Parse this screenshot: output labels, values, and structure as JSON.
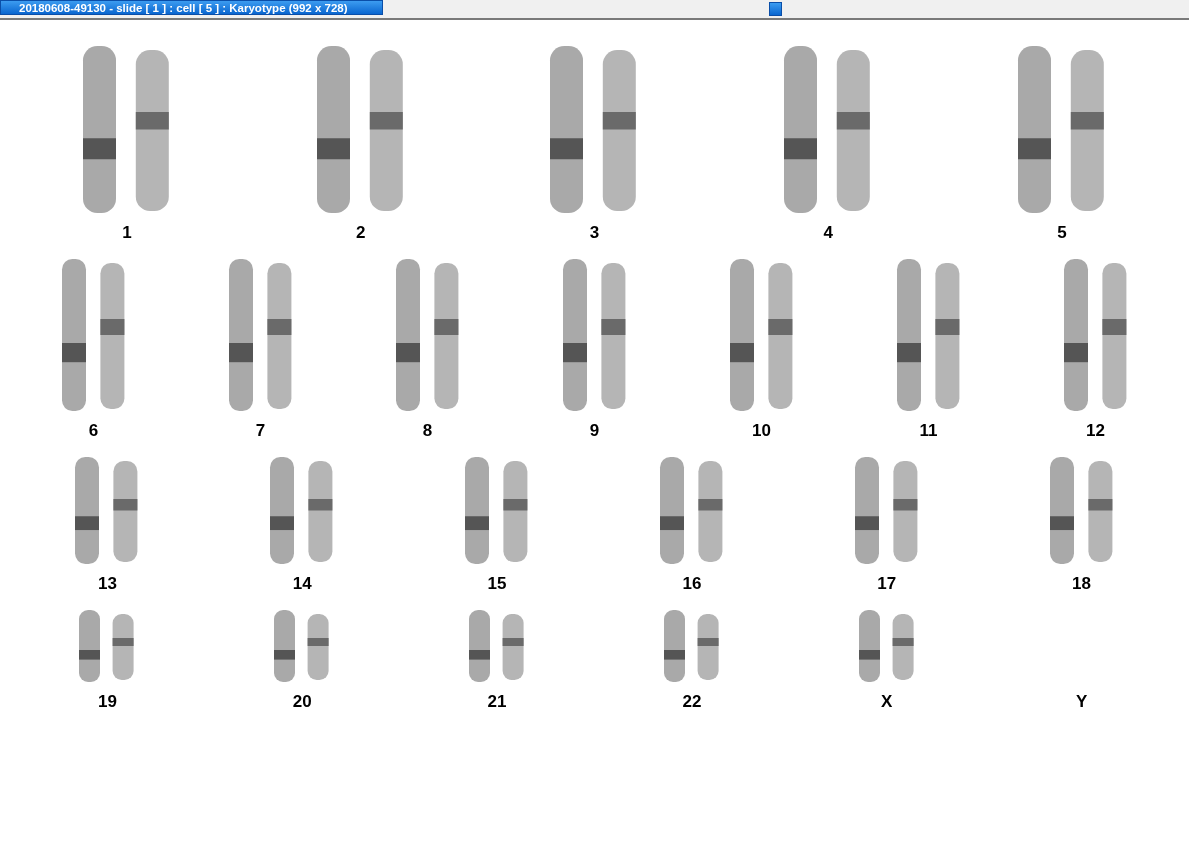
{
  "window": {
    "title": "20180608-49130 - slide [ 1 ] : cell [ 5 ] : Karyotype  (992 x 728)"
  },
  "rows": [
    [
      {
        "label": "1",
        "kind": "pair"
      },
      {
        "label": "2",
        "kind": "pair"
      },
      {
        "label": "3",
        "kind": "pair"
      },
      {
        "label": "4",
        "kind": "pair"
      },
      {
        "label": "5",
        "kind": "pair"
      }
    ],
    [
      {
        "label": "6",
        "kind": "pair"
      },
      {
        "label": "7",
        "kind": "pair"
      },
      {
        "label": "8",
        "kind": "pair"
      },
      {
        "label": "9",
        "kind": "pair"
      },
      {
        "label": "10",
        "kind": "pair"
      },
      {
        "label": "11",
        "kind": "pair"
      },
      {
        "label": "12",
        "kind": "pair"
      }
    ],
    [
      {
        "label": "13",
        "kind": "pair"
      },
      {
        "label": "14",
        "kind": "pair"
      },
      {
        "label": "15",
        "kind": "pair"
      },
      {
        "label": "16",
        "kind": "pair"
      },
      {
        "label": "17",
        "kind": "pair"
      },
      {
        "label": "18",
        "kind": "pair"
      }
    ],
    [
      {
        "label": "19",
        "kind": "pair"
      },
      {
        "label": "20",
        "kind": "pair"
      },
      {
        "label": "21",
        "kind": "pair"
      },
      {
        "label": "22",
        "kind": "pair"
      },
      {
        "label": "X",
        "kind": "pair"
      },
      {
        "label": "Y",
        "kind": "empty"
      }
    ]
  ]
}
